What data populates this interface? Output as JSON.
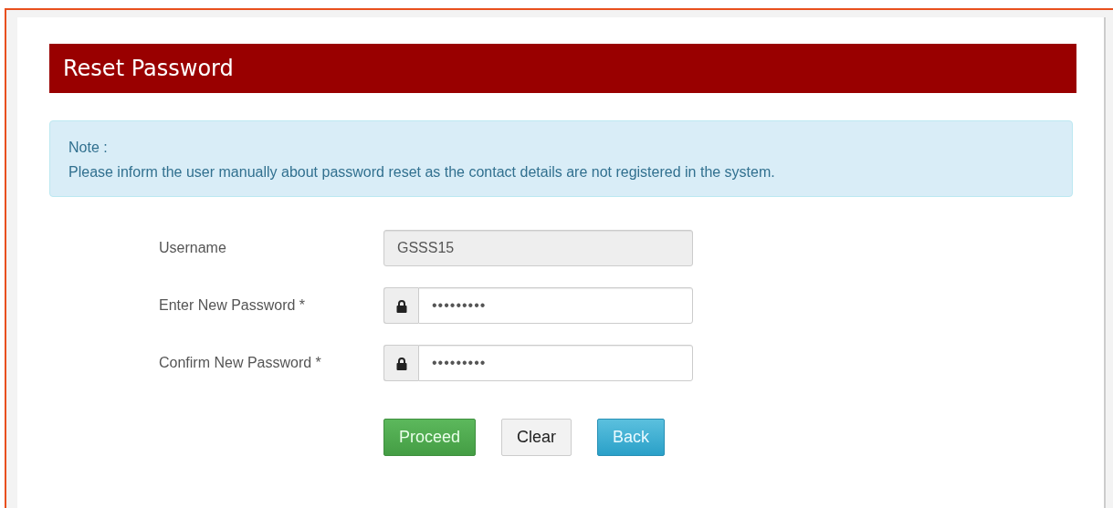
{
  "header": {
    "title": "Reset Password"
  },
  "note": {
    "title": "Note :",
    "message": "Please inform the user manually about password reset as the contact details are not registered in the system."
  },
  "fields": [
    {
      "kind": "text",
      "label": "Username",
      "value": "GSSS15",
      "disabled": true
    },
    {
      "kind": "password",
      "label": "Enter New Password *",
      "value": "•••••••••",
      "disabled": false
    },
    {
      "kind": "password",
      "label": "Confirm New Password *",
      "value": "•••••••••",
      "disabled": false
    }
  ],
  "buttons": [
    {
      "kind": "success",
      "label": "Proceed"
    },
    {
      "kind": "default",
      "label": "Clear"
    },
    {
      "kind": "info",
      "label": "Back"
    }
  ]
}
